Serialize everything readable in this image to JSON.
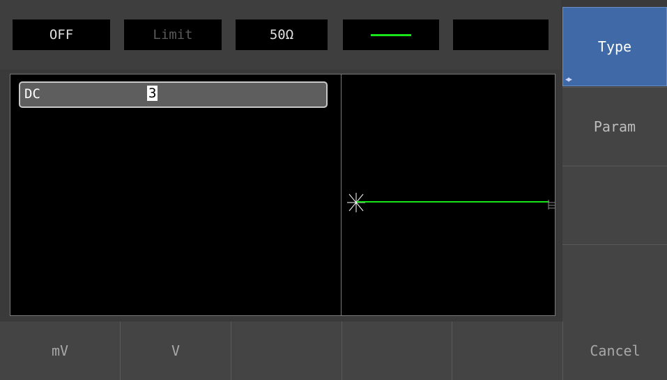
{
  "status": {
    "output": "OFF",
    "limit": "Limit",
    "load": "50Ω",
    "wave_color": "#19e619"
  },
  "param": {
    "label": "DC",
    "value": "3"
  },
  "softkeys": {
    "type": "Type",
    "param": "Param",
    "blank1": "",
    "blank2": ""
  },
  "bottom": {
    "mv": "mV",
    "v": "V",
    "blank1": "",
    "blank2": "",
    "blank3": "",
    "cancel": "Cancel"
  },
  "colors": {
    "accent": "#3f6aa7",
    "trace": "#19e619"
  }
}
